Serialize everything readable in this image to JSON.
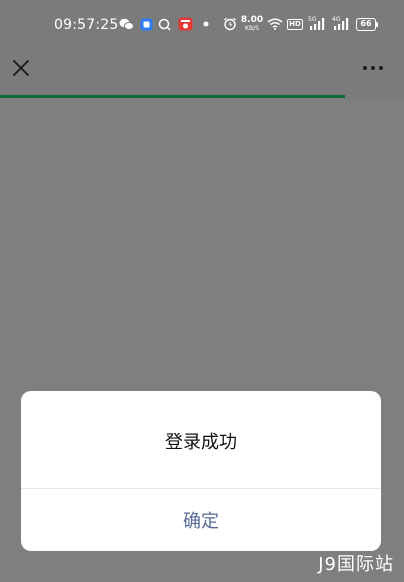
{
  "status_bar": {
    "time": "09:57:25",
    "net_speed_value": "8.00",
    "net_speed_unit": "KB/S",
    "hd_label": "HD",
    "signal1_label": "5G",
    "signal2_label": "4G",
    "battery": "66",
    "icons": [
      "wechat-icon",
      "app-blue-icon",
      "chat-bubble-icon",
      "app-red-icon",
      "dot-icon",
      "alarm-icon",
      "wifi-icon",
      "hd-icon",
      "signal-5g-icon",
      "signal-4g-icon",
      "battery-icon"
    ]
  },
  "navbar": {
    "close_icon": "close-icon",
    "more_icon": "more-dots-icon"
  },
  "progress": {
    "fraction": 0.855,
    "color": "#0c6a3b"
  },
  "dialog": {
    "message": "登录成功",
    "confirm_label": "确定",
    "confirm_color": "#576b95"
  },
  "watermark": {
    "text": "J9国际站"
  }
}
